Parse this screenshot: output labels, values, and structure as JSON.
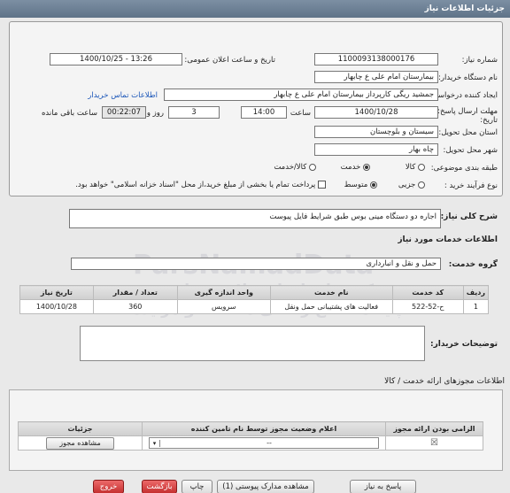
{
  "page_title": "جزئیات اطلاعات نیاز",
  "form": {
    "need_number_label": "شماره نیاز:",
    "need_number": "1100093138000176",
    "announce_label": "تاریخ و ساعت اعلان عمومی:",
    "announce_value": "1400/10/25 - 13:26",
    "buyer_label": "نام دستگاه خریدار:",
    "buyer_value": "بیمارستان امام علی  ع  چابهار",
    "creator_label": "ایجاد کننده درخواست:",
    "creator_value": "جمشید ریگی کارپرداز بیمارستان امام علی  ع  چابهار",
    "contact_link": "اطلاعات تماس خریدار",
    "deadline_label": "مهلت ارسال پاسخ: تا تاریخ:",
    "deadline_date": "1400/10/28",
    "time_label": "ساعت",
    "deadline_time": "14:00",
    "days_value": "3",
    "days_label": "روز و",
    "remaining_time": "00:22:07",
    "remaining_label": "ساعت باقی مانده",
    "province_label": "استان محل تحویل:",
    "province_value": "سیستان و بلوچستان",
    "city_label": "شهر محل تحویل:",
    "city_value": "چاه بهار",
    "category_label": "طبقه بندی موضوعی:",
    "category_options": [
      "کالا",
      "خدمت",
      "کالا/خدمت"
    ],
    "process_label": "نوع فرآیند خرید :",
    "process_options": [
      "جزیی",
      "متوسط"
    ],
    "process_note": "پرداخت تمام یا بخشی از مبلغ خرید،از محل \"اسناد خزانه اسلامی\" خواهد بود."
  },
  "description_label": "شرح کلی نیاز:",
  "description_value": "اجاره دو دستگاه مینی بوس طبق شرایط فایل پیوست",
  "services_title": "اطلاعات خدمات مورد نیاز",
  "service_group_label": "گروه خدمت:",
  "service_group_value": "حمل و نقل و انبارداری",
  "table": {
    "headers": [
      "ردیف",
      "کد خدمت",
      "نام خدمت",
      "واحد اندازه گیری",
      "تعداد / مقدار",
      "تاریخ نیاز"
    ],
    "rows": [
      [
        "1",
        "ح-52-522",
        "فعالیت های پشتیبانی حمل ونقل",
        "سرویس",
        "360",
        "1400/10/28"
      ]
    ]
  },
  "buyer_notes_label": "توضیحات خریدار:",
  "permits_title": "اطلاعات مجوزهای ارائه خدمت / کالا",
  "permits_table": {
    "headers": [
      "الزامی بودن ارائه مجوز",
      "اعلام وضعیت مجوز توسط نام تامین کننده",
      "جزئیات"
    ],
    "select_value": "--",
    "details_button": "مشاهده مجوز"
  },
  "watermark": {
    "brand": "ParsNamadData",
    "line1": "مرکز فراخوان استعلام و مناقصه",
    "line2": "پایگاه اطلاع رسانی مناقصه و مزایده",
    "phone": "۰۲۱-۸۸۳۴۹۶۷۰-۵"
  },
  "buttons": {
    "reply": "پاسخ به نیاز",
    "view_docs": "مشاهده مدارک پیوستی (1)",
    "print": "چاپ",
    "back": "بازگشت",
    "exit": "خروج"
  }
}
